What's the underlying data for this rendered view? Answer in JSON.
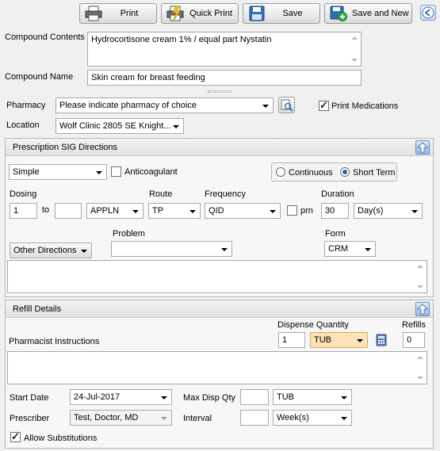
{
  "toolbar": {
    "print": "Print",
    "quick_print": "Quick Print",
    "save": "Save",
    "save_and_new": "Save and New"
  },
  "compound": {
    "contents_label": "Compound Contents",
    "contents_value": "Hydrocortisone cream 1% / equal part Nystatin",
    "name_label": "Compound Name",
    "name_value": "Skin cream for breast feeding"
  },
  "pharmacy": {
    "label": "Pharmacy",
    "value": "Please indicate pharmacy of choice",
    "print_meds_label": "Print Medications",
    "print_meds_checked": true,
    "location_label": "Location",
    "location_value": "Wolf Clinic 2805 SE Knight..."
  },
  "sig": {
    "title": "Prescription SIG Directions",
    "mode": "Simple",
    "anticoagulant_label": "Anticoagulant",
    "continuous_label": "Continuous",
    "short_term_label": "Short Term",
    "selected_term": "Short Term",
    "dosing_label": "Dosing",
    "dose_from": "1",
    "to_label": "to",
    "dose_to": "",
    "dose_unit": "APPLN",
    "route_label": "Route",
    "route": "TP",
    "frequency_label": "Frequency",
    "frequency": "QID",
    "prn_label": "prn",
    "duration_label": "Duration",
    "duration": "30",
    "duration_unit": "Day(s)",
    "other_directions": "Other Directions",
    "problem_label": "Problem",
    "problem": "",
    "form_label": "Form",
    "form": "CRM",
    "directions_text": ""
  },
  "refill": {
    "title": "Refill Details",
    "dispense_qty_label": "Dispense Quantity",
    "refills_label": "Refills",
    "pharmacist_instructions_label": "Pharmacist Instructions",
    "dispense_qty": "1",
    "dispense_unit": "TUB",
    "refills": "0",
    "instructions_text": "",
    "start_date_label": "Start Date",
    "start_date": "24-Jul-2017",
    "max_disp_label": "Max Disp Qty",
    "max_disp_qty": "",
    "max_disp_unit": "TUB",
    "prescriber_label": "Prescriber",
    "prescriber": "Test, Doctor, MD",
    "interval_label": "Interval",
    "interval": "",
    "interval_unit": "Week(s)",
    "allow_substitutions_label": "Allow Substitutions",
    "allow_substitutions": true
  }
}
